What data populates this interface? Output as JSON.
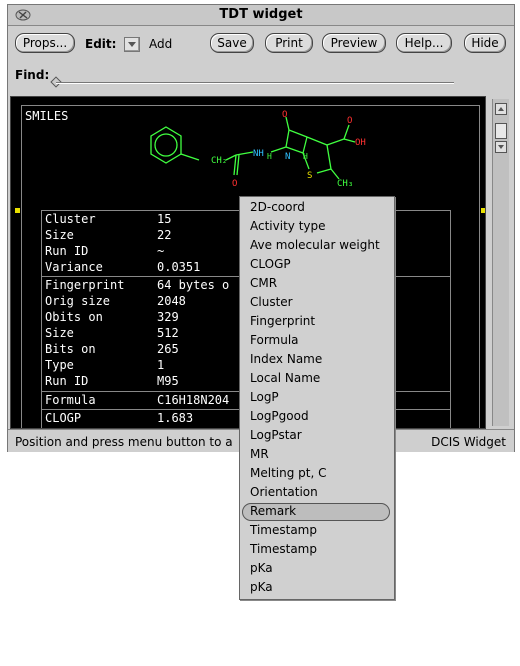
{
  "window": {
    "title": "TDT widget"
  },
  "toolbar": {
    "props_label": "Props...",
    "edit_label": "Edit:",
    "add_label": "Add",
    "save_label": "Save",
    "print_label": "Print",
    "preview_label": "Preview",
    "help_label": "Help...",
    "hide_label": "Hide"
  },
  "find": {
    "label": "Find:",
    "value": ""
  },
  "panel": {
    "smiles_label": "SMILES",
    "molecule_labels": {
      "ch2": "CH₂",
      "nh": "NH",
      "o1": "O",
      "o2": "O",
      "o3": "O",
      "oh": "OH",
      "h1": "H",
      "h2": "H",
      "n": "N",
      "s": "S",
      "ch3": "CH₃"
    },
    "groups": [
      {
        "rows": [
          {
            "key": "Cluster",
            "value": "15"
          },
          {
            "key": "Size",
            "value": "22"
          },
          {
            "key": "Run ID",
            "value": "~"
          },
          {
            "key": "Variance",
            "value": "0.0351"
          }
        ]
      },
      {
        "rows": [
          {
            "key": "Fingerprint",
            "value": "64 bytes o"
          },
          {
            "key": "Orig size",
            "value": "2048"
          },
          {
            "key": "Obits on",
            "value": "329"
          },
          {
            "key": "Size",
            "value": "512"
          },
          {
            "key": "Bits on",
            "value": "265"
          },
          {
            "key": "Type",
            "value": "1"
          },
          {
            "key": "Run ID",
            "value": "M95"
          }
        ]
      },
      {
        "rows": [
          {
            "key": "Formula",
            "value": "C16H18N204"
          }
        ]
      },
      {
        "rows": [
          {
            "key": "CLOGP",
            "value": "1.683"
          }
        ]
      }
    ]
  },
  "status": {
    "message": "Position and press menu button to a",
    "right": "DCIS Widget"
  },
  "context_menu": {
    "items": [
      "2D-coord",
      "Activity type",
      "Ave molecular weight",
      "CLOGP",
      "CMR",
      "Cluster",
      "Fingerprint",
      "Formula",
      "Index Name",
      "Local Name",
      "LogP",
      "LogPgood",
      "LogPstar",
      "MR",
      "Melting pt, C",
      "Orientation",
      "Remark",
      "Timestamp",
      "Timestamp",
      "pKa",
      "pKa"
    ],
    "selected": "Remark"
  },
  "colors": {
    "molecule_ring": "#40ff40",
    "heteroatom_oxygen": "#ff3030",
    "heteroatom_nitrogen": "#30c0ff",
    "sulfur": "#e8e000"
  }
}
